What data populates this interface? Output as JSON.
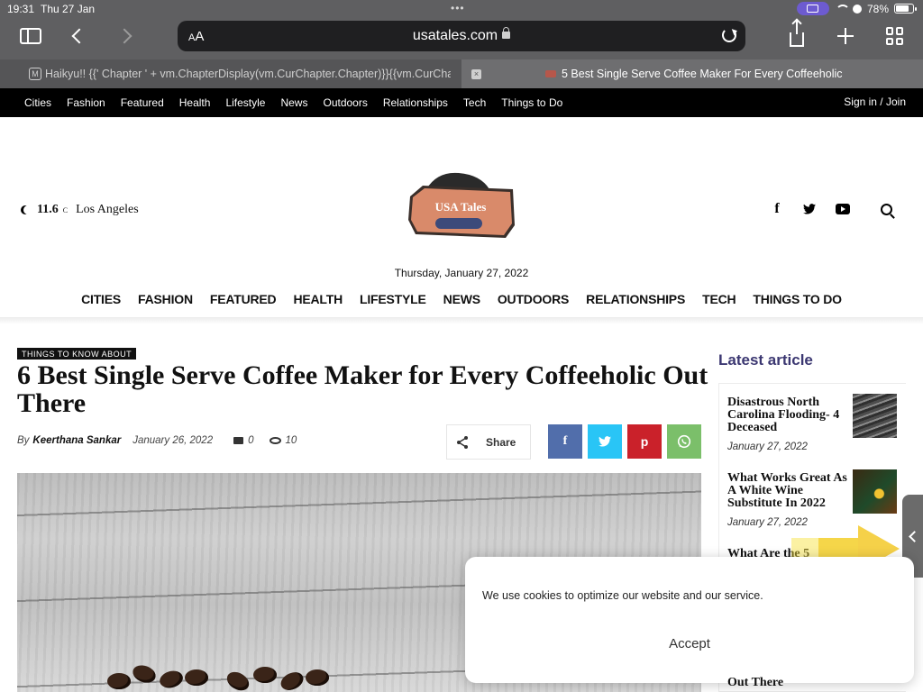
{
  "status_bar": {
    "time": "19:31",
    "date": "Thu 27 Jan",
    "battery_percent": "78%",
    "battery_level": 0.78
  },
  "browser": {
    "aa_label": "AA",
    "url": "usatales.com",
    "tabs": [
      {
        "favicon_letter": "M",
        "title": "Haikyu!! {{' Chapter ' + vm.ChapterDisplay(vm.CurChapter.Chapter)}}{{vm.CurChapter.Chapter}}"
      },
      {
        "close": "×",
        "title": "5 Best Single Serve Coffee Maker For Every Coffeeholic"
      }
    ]
  },
  "topbar": {
    "items": [
      "Cities",
      "Fashion",
      "Featured",
      "Health",
      "Lifestyle",
      "News",
      "Outdoors",
      "Relationships",
      "Tech",
      "Things to Do"
    ],
    "signin": "Sign in / Join"
  },
  "header": {
    "temperature": "11.6",
    "unit": "C",
    "city": "Los Angeles",
    "logo_text": "USA Tales",
    "date": "Thursday, January 27, 2022",
    "social": {
      "facebook": "f"
    }
  },
  "main_nav": [
    "CITIES",
    "FASHION",
    "FEATURED",
    "HEALTH",
    "LIFESTYLE",
    "NEWS",
    "OUTDOORS",
    "RELATIONSHIPS",
    "TECH",
    "THINGS TO DO"
  ],
  "article": {
    "category": "THINGS TO KNOW ABOUT",
    "title": "6 Best Single Serve Coffee Maker for Every Coffeeholic Out There",
    "by": "By",
    "author": "Keerthana Sankar",
    "date": "January 26, 2022",
    "comments": "0",
    "views": "10",
    "share_label": "Share",
    "share_buttons": {
      "facebook": "f",
      "pinterest": "p"
    }
  },
  "sidebar": {
    "title": "Latest article",
    "items": [
      {
        "title": "Disastrous North Carolina Flooding- 4 Deceased",
        "date": "January 27, 2022"
      },
      {
        "title": "What Works Great As A White Wine Substitute In 2022",
        "date": "January 27, 2022"
      },
      {
        "title": "What Are the 5"
      }
    ],
    "peek_text": "Out There"
  },
  "cookie": {
    "message": "We use cookies to optimize our website and our service.",
    "accept": "Accept"
  },
  "colors": {
    "accent_title": "#3b3771",
    "facebook": "#516eab",
    "twitter": "#29c5f6",
    "pinterest": "#ca212a",
    "whatsapp": "#7bbf6a"
  }
}
